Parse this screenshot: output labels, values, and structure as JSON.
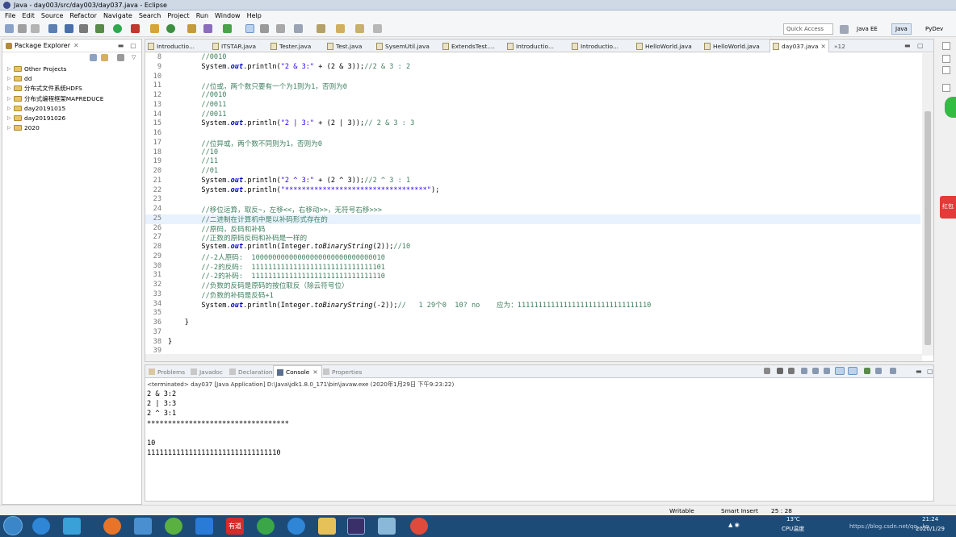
{
  "window": {
    "title": "Java - day003/src/day003/day037.java - Eclipse"
  },
  "menu": [
    "File",
    "Edit",
    "Source",
    "Refactor",
    "Navigate",
    "Search",
    "Project",
    "Run",
    "Window",
    "Help"
  ],
  "toolbar": {
    "quick_access": "Quick Access",
    "perspectives": [
      "Java EE",
      "Java",
      "PyDev"
    ]
  },
  "package_explorer": {
    "title": "Package Explorer",
    "items": [
      "Other Projects",
      "dd",
      "分布式文件系统HDFS",
      "分布式编程框架MAPREDUCE",
      "day20191015",
      "day20191026",
      "2020"
    ]
  },
  "editor": {
    "tabs": [
      "Introductio...",
      "ITSTAR.java",
      "Tester.java",
      "Test.java",
      "SysemUtil.java",
      "ExtendsTest....",
      "Introductio...",
      "Introductio...",
      "HelloWorld.java",
      "HelloWorld.java",
      "day037.java"
    ],
    "overflow_count": "12",
    "lines": [
      {
        "n": "8",
        "t": "        //0010"
      },
      {
        "n": "9",
        "t": "        System.out.println(\"2 & 3:\" + (2 & 3));//2 & 3 : 2"
      },
      {
        "n": "10",
        "t": ""
      },
      {
        "n": "11",
        "t": "        //位或，两个数只要有一个为1则为1，否则为0"
      },
      {
        "n": "12",
        "t": "        //0010"
      },
      {
        "n": "13",
        "t": "        //0011"
      },
      {
        "n": "14",
        "t": "        //0011"
      },
      {
        "n": "15",
        "t": "        System.out.println(\"2 | 3:\" + (2 | 3));// 2 & 3 : 3"
      },
      {
        "n": "16",
        "t": ""
      },
      {
        "n": "17",
        "t": "        //位异或，两个数不同则为1，否则为0"
      },
      {
        "n": "18",
        "t": "        //10"
      },
      {
        "n": "19",
        "t": "        //11"
      },
      {
        "n": "20",
        "t": "        //01"
      },
      {
        "n": "21",
        "t": "        System.out.println(\"2 ^ 3:\" + (2 ^ 3));//2 ^ 3 : 1"
      },
      {
        "n": "22",
        "t": "        System.out.println(\"**********************************\");"
      },
      {
        "n": "23",
        "t": ""
      },
      {
        "n": "24",
        "t": "        //移位运算，取反~，左移<<，右移动>>，无符号右移>>>"
      },
      {
        "n": "25",
        "t": "        //二进制在计算机中是以补码形式存在的"
      },
      {
        "n": "26",
        "t": "        //原码，反码和补码"
      },
      {
        "n": "27",
        "t": "        //正数的原码反码和补码是一样的"
      },
      {
        "n": "28",
        "t": "        System.out.println(Integer.toBinaryString(2));//10"
      },
      {
        "n": "29",
        "t": "        //-2人原码:  10000000000000000000000000000010"
      },
      {
        "n": "30",
        "t": "        //-2的反码:  11111111111111111111111111111101"
      },
      {
        "n": "31",
        "t": "        //-2的补码:  11111111111111111111111111111110"
      },
      {
        "n": "32",
        "t": "        //负数的反码是原码的按位取反（除云符号位）"
      },
      {
        "n": "33",
        "t": "        //负数的补码是反码+1"
      },
      {
        "n": "34",
        "t": "        System.out.println(Integer.toBinaryString(-2));//   1 29个0  10? no    应为：11111111111111111111111111111110"
      },
      {
        "n": "35",
        "t": ""
      },
      {
        "n": "36",
        "t": "    }"
      },
      {
        "n": "37",
        "t": ""
      },
      {
        "n": "38",
        "t": "}"
      },
      {
        "n": "39",
        "t": ""
      }
    ],
    "current_line": "25"
  },
  "console": {
    "tabs": [
      "Problems",
      "Javadoc",
      "Declaration",
      "Console",
      "Properties"
    ],
    "active_tab": "Console",
    "terminated": "<terminated> day037 [Java Application] D:\\Java\\jdk1.8.0_171\\bin\\javaw.exe (2020年1月29日 下午9:23:22)",
    "output": [
      "2 & 3:2",
      "2 | 3:3",
      "2 ^ 3:1",
      "**********************************",
      "10",
      "11111111111111111111111111111110"
    ]
  },
  "status": {
    "mode": "Writable",
    "insert": "Smart Insert",
    "position": "25 : 28"
  },
  "taskbar": {
    "temp": "13℃",
    "temp_label": "CPU温度",
    "time": "21:24",
    "date": "2020/1/29",
    "watermark": "https://blog.csdn.net/qq...ko",
    "youdao": "有道",
    "redbadge": "红包"
  },
  "colors": {
    "accent": "#3b6fb6",
    "keyword": "#7f0055",
    "string": "#2a00ff",
    "comment": "#3f7f5f"
  }
}
